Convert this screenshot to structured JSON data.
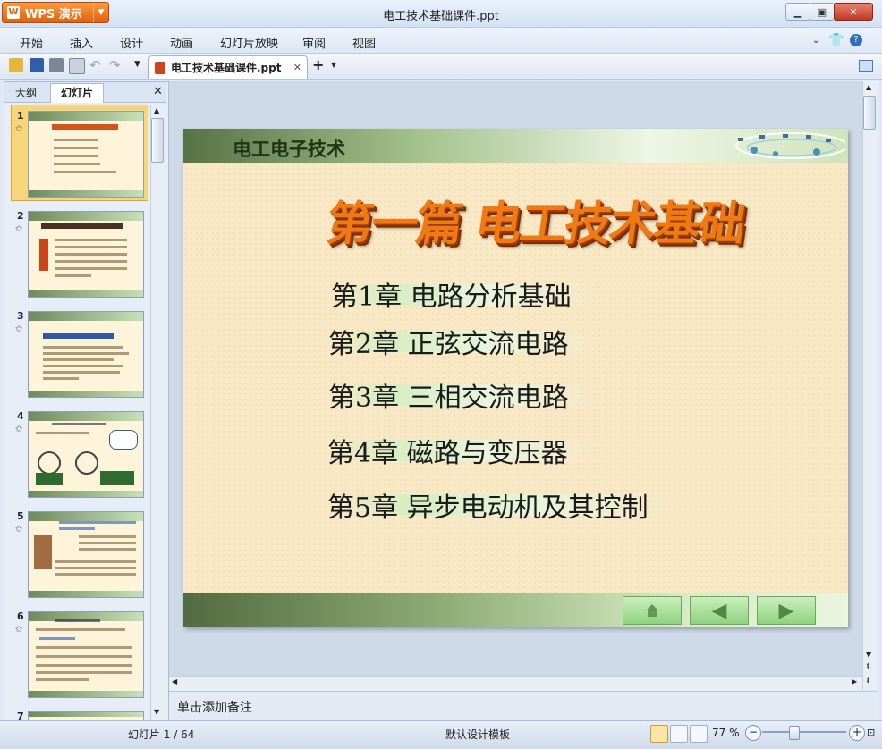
{
  "app": {
    "name": "WPS 演示",
    "window_title": "电工技术基础课件.ppt"
  },
  "menu": [
    "开始",
    "插入",
    "设计",
    "动画",
    "幻灯片放映",
    "审阅",
    "视图"
  ],
  "document_tab": {
    "label": "电工技术基础课件.ppt"
  },
  "left_pane": {
    "tabs": [
      "大纲",
      "幻灯片"
    ],
    "active_tab": "幻灯片",
    "slide_numbers": [
      "1",
      "2",
      "3",
      "4",
      "5",
      "6",
      "7"
    ]
  },
  "slide": {
    "company": "电工电子技术",
    "title": "第一篇 电工技术基础",
    "chapters": [
      "第1章  电路分析基础",
      "第2章  正弦交流电路",
      "第3章  三相交流电路",
      "第4章  磁路与变压器",
      "第5章  异步电动机及其控制"
    ]
  },
  "notes_placeholder": "单击添加备注",
  "status": {
    "slide_counter": "幻灯片 1 / 64",
    "template": "默认设计模板",
    "zoom": "77 %"
  },
  "colors": {
    "accent_orange": "#e2600d",
    "slide_title": "#ef7a14",
    "header_green": "#577346"
  }
}
